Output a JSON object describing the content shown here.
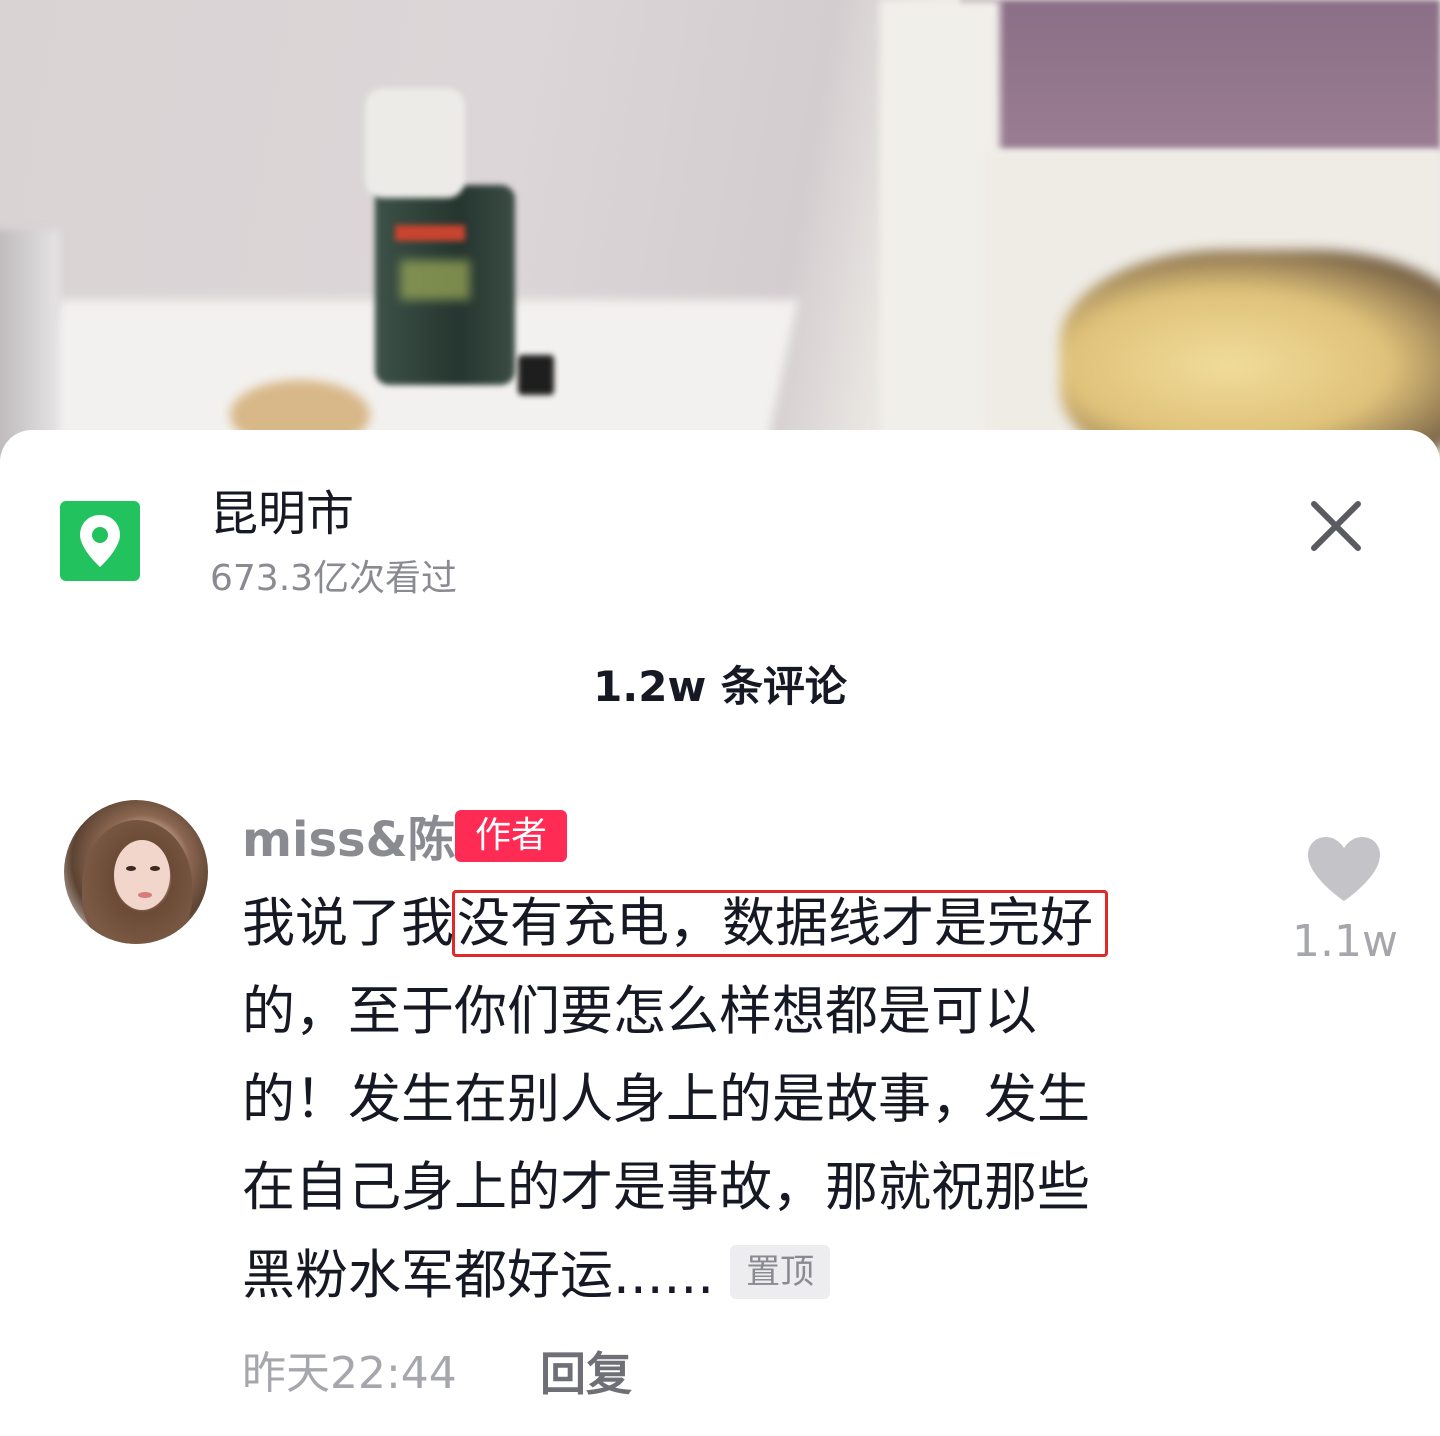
{
  "location": {
    "title": "昆明市",
    "views": "673.3亿次看过",
    "icon": "location-pin-icon",
    "icon_color": "#22c25f"
  },
  "comments_header": {
    "count_label": "1.2w 条评论"
  },
  "comment": {
    "username": "miss&陈",
    "author_badge": "作者",
    "text_lines": {
      "line1_prefix": "我说了我",
      "line1_highlight": "没有充电，数据线才是完好",
      "line2": "的，至于你们要怎么样想都是可以",
      "line3": "的！发生在别人身上的是故事，发生",
      "line4": "在自己身上的才是事故，那就祝那些",
      "line5": "黑粉水军都好运......"
    },
    "pinned_badge": "置顶",
    "time": "昨天22:44",
    "reply_label": "回复",
    "like_count": "1.1w"
  },
  "colors": {
    "author_badge_bg": "#fe2c55",
    "highlight_border": "#e02a2a"
  }
}
